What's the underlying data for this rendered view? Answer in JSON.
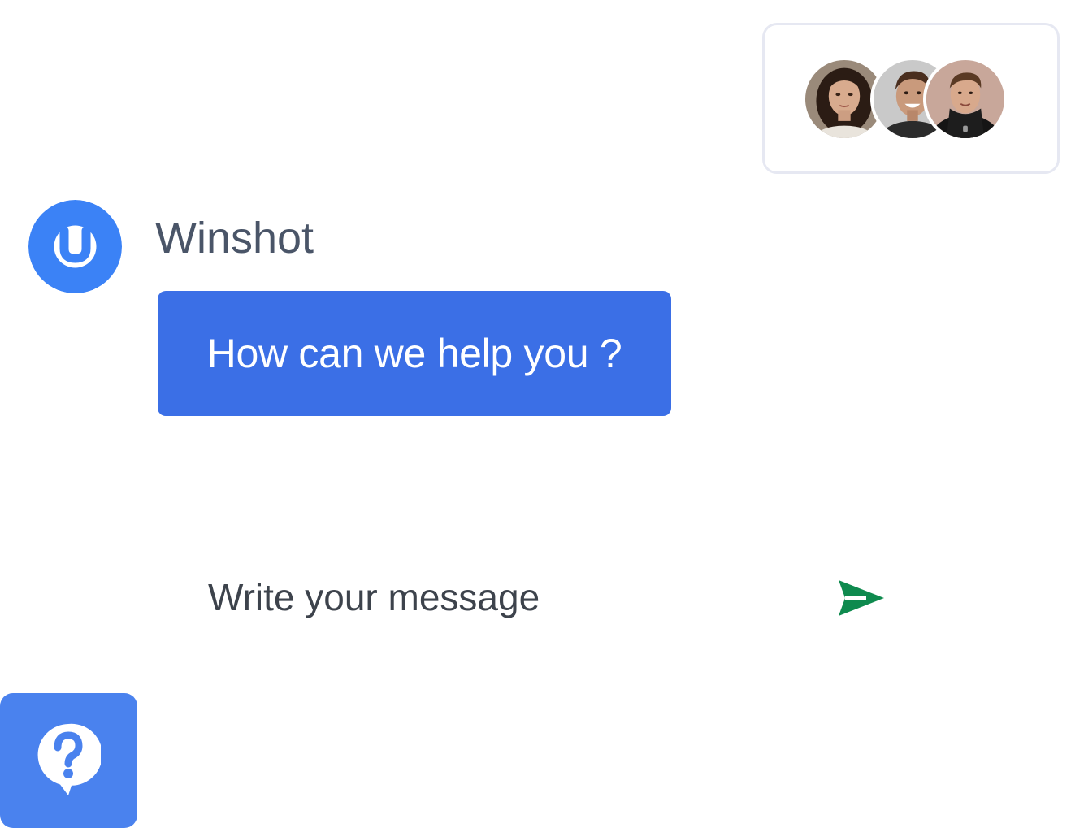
{
  "agents": {
    "avatars": [
      {
        "icon": "agent-avatar-woman"
      },
      {
        "icon": "agent-avatar-smiling-man"
      },
      {
        "icon": "agent-avatar-man-hoodie"
      }
    ]
  },
  "brand": {
    "name": "Winshot",
    "logo_icon": "winshot-u-logo-icon",
    "logo_color": "#3b82f6"
  },
  "greeting": {
    "text": "How can we help you ?",
    "bubble_color": "#3b6fe6"
  },
  "composer": {
    "placeholder": "Write your message",
    "send_icon": "send-icon",
    "send_color": "#0e8a4e"
  },
  "launcher": {
    "icon": "question-bubble-icon",
    "color": "#4a82ee"
  }
}
